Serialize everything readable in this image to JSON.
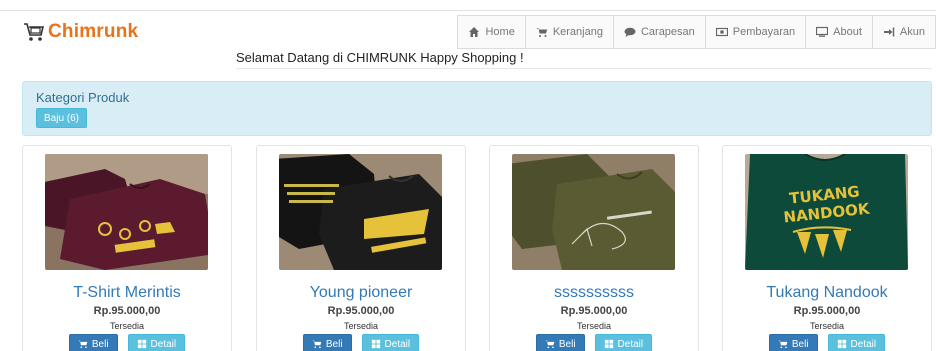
{
  "brand": {
    "name": "Chimrunk",
    "icon": "cart-logo-icon",
    "color": "#e8731a"
  },
  "nav": [
    {
      "label": "Home",
      "icon": "home-icon"
    },
    {
      "label": "Keranjang",
      "icon": "cart-icon"
    },
    {
      "label": "Carapesan",
      "icon": "comment-icon"
    },
    {
      "label": "Pembayaran",
      "icon": "money-icon"
    },
    {
      "label": "About",
      "icon": "monitor-icon"
    },
    {
      "label": "Akun",
      "icon": "login-icon"
    }
  ],
  "welcome": "Selamat Datang di CHIMRUNK Happy Shopping !",
  "kategori": {
    "title": "Kategori Produk",
    "button": "Baju (6)"
  },
  "products": [
    {
      "name": "T-Shirt Merintis",
      "price": "Rp.95.000,00",
      "status": "Tersedia",
      "beli": "Beli",
      "detail": "Detail",
      "image": "maroon-tshirt-photo"
    },
    {
      "name": "Young pioneer",
      "price": "Rp.95.000,00",
      "status": "Tersedia",
      "beli": "Beli",
      "detail": "Detail",
      "image": "black-tshirt-photo"
    },
    {
      "name": "ssssssssss",
      "price": "Rp.95.000,00",
      "status": "Tersedia",
      "beli": "Beli",
      "detail": "Detail",
      "image": "olive-tshirt-photo"
    },
    {
      "name": "Tukang Nandook",
      "price": "Rp.95.000,00",
      "status": "Tersedia",
      "beli": "Beli",
      "detail": "Detail",
      "image": "green-tshirt-photo",
      "print_lines": [
        "TUKANG",
        "NANDOOK"
      ]
    }
  ],
  "colors": {
    "primary": "#337ab7",
    "info": "#5bc0de",
    "panel_bg": "#d9edf7"
  }
}
